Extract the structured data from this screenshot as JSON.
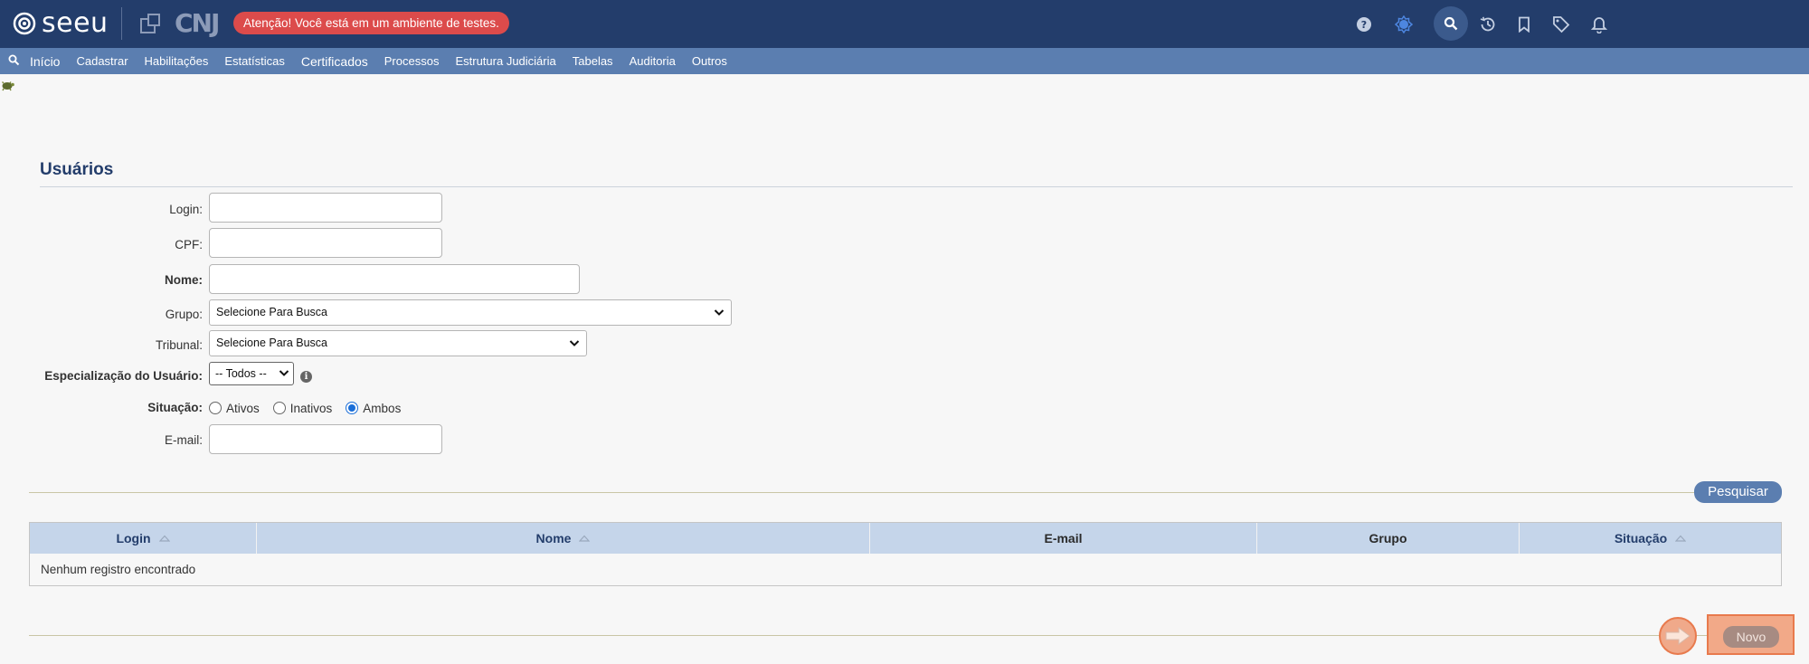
{
  "header": {
    "logo_text": "seeu",
    "cnj_text": "CNJ",
    "warning": "Atenção! Você está em um ambiente de testes.",
    "icons": [
      "help-icon",
      "theme-icon",
      "search-icon",
      "history-icon",
      "bookmark-icon",
      "tag-icon",
      "bell-icon"
    ]
  },
  "menu": {
    "items": [
      "Início",
      "Cadastrar",
      "Habilitações",
      "Estatísticas",
      "Certificados",
      "Processos",
      "Estrutura Judiciária",
      "Tabelas",
      "Auditoria",
      "Outros"
    ]
  },
  "page": {
    "title": "Usuários"
  },
  "form": {
    "login_label": "Login:",
    "login_value": "",
    "cpf_label": "CPF:",
    "cpf_value": "",
    "nome_label": "Nome:",
    "nome_value": "",
    "grupo_label": "Grupo:",
    "grupo_value": "Selecione Para Busca",
    "tribunal_label": "Tribunal:",
    "tribunal_value": "Selecione Para Busca",
    "especializacao_label": "Especialização do Usuário:",
    "especializacao_value": "-- Todos --",
    "situacao_label": "Situação:",
    "situacao_options": [
      "Ativos",
      "Inativos",
      "Ambos"
    ],
    "situacao_selected": "Ambos",
    "email_label": "E-mail:",
    "email_value": "",
    "search_button": "Pesquisar"
  },
  "table": {
    "columns": [
      "Login",
      "Nome",
      "E-mail",
      "Grupo",
      "Situação"
    ],
    "empty_message": "Nenhum registro encontrado",
    "rows": []
  },
  "actions": {
    "new_button": "Novo"
  },
  "colors": {
    "header_bg": "#233d6b",
    "menu_bg": "#5b7eb0",
    "warning_bg": "#dc4b4b",
    "table_header_bg": "#c5d5ea",
    "highlight": "#e87a4d"
  }
}
